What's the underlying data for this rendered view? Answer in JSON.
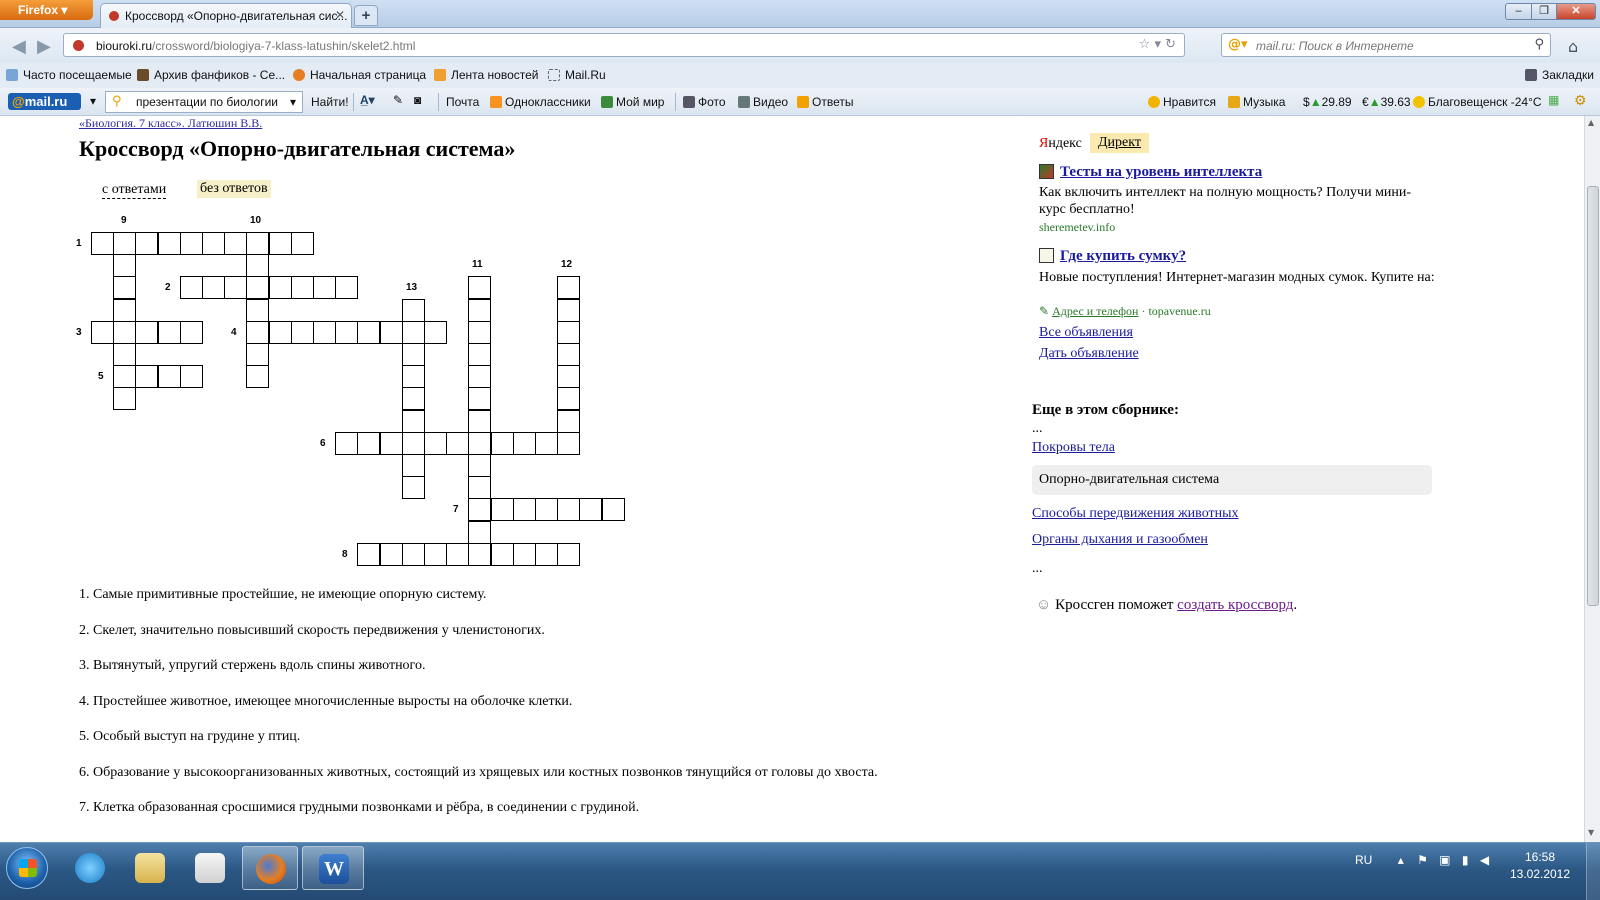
{
  "browser": {
    "app_button": "Firefox",
    "tab_title": "Кроссворд «Опорно-двигательная сис...",
    "url_host": "biouroki.ru",
    "url_path": "/crossword/biologiya-7-klass-latushin/skelet2.html",
    "search_placeholder": "mail.ru: Поиск в Интернете"
  },
  "bookmarks": [
    "Часто посещаемые",
    "Архив фанфиков - Се...",
    "Начальная страница",
    "Лента новостей",
    "Mail.Ru",
    "Закладки"
  ],
  "mailbar": {
    "logo": "mail.ru",
    "query": "презентации по биологии",
    "find": "Найти!",
    "links": [
      "Почта",
      "Одноклассники",
      "Мой мир",
      "Фото",
      "Видео",
      "Ответы"
    ],
    "like": "Нравится",
    "music": "Музыка",
    "usd": "29.89",
    "eur": "39.63",
    "weather": "Благовещенск -24°C"
  },
  "page": {
    "breadcrumb": "«Биология. 7 класс». Латюшин В.В.",
    "title": "Кроссворд «Опорно-двигательная система»",
    "tab_with": "с ответами",
    "tab_without": "без ответов"
  },
  "crossword": {
    "numbers": [
      "1",
      "2",
      "3",
      "4",
      "5",
      "6",
      "7",
      "8",
      "9",
      "10",
      "11",
      "12",
      "13"
    ]
  },
  "clues": [
    "1. Самые примитивные простейшие, не имеющие опорную систему.",
    "2. Скелет, значительно повысивший скорость передвижения у членистоногих.",
    "3. Вытянутый, упругий стержень вдоль спины животного.",
    "4. Простейшее животное, имеющее многочисленные выросты на оболочке клетки.",
    "5. Особый выступ на грудине у птиц.",
    "6. Образование у высокоорганизованных животных, состоящий из хрящевых или костных позвонков тянущийся от головы до хвоста.",
    "7. Клетка образованная сросшимися грудными позвонками и рёбра, в соединении с грудиной."
  ],
  "sidebar": {
    "yandex": "ндекс",
    "yandex_y": "Я",
    "direct": "Директ",
    "ad1_title": "Тесты на уровень интеллекта",
    "ad1_text": "Как включить интеллект на полную мощность? Получи мини-курс бесплатно!",
    "ad1_domain": "sheremetev.info",
    "ad2_title": "Где купить сумку?",
    "ad2_text": "Новые поступления! Интернет-магазин модных сумок. Купите на:",
    "ad2_address": "Адрес и телефон",
    "ad2_domain": "topavenue.ru",
    "all_ads": "Все объявления",
    "give_ad": "Дать объявление",
    "more_title": "Еще в этом сборнике:",
    "dots": "...",
    "items": [
      "Покровы тела",
      "Опорно-двигательная система",
      "Способы передвижения животных",
      "Органы дыхания и газообмен"
    ],
    "note_prefix": "Кроссген поможет ",
    "note_link": "создать кроссворд",
    "note_suffix": "."
  },
  "taskbar": {
    "lang": "RU",
    "time": "16:58",
    "date": "13.02.2012"
  },
  "colors": {
    "link": "#1a1a9c",
    "firefox_orange": "#e67e22",
    "taskbar": "#2c5885",
    "direct_bg": "#fbeab0"
  }
}
